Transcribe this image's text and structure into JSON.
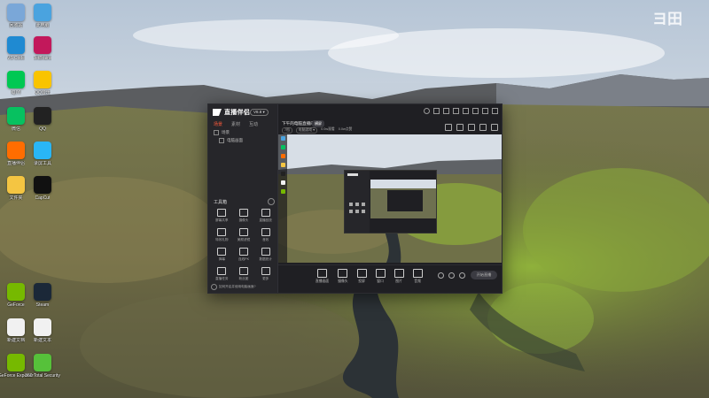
{
  "desktop": {
    "icons": [
      {
        "label": "回收站",
        "icon": "recycle-bin-icon",
        "color": "#7aa7d8"
      },
      {
        "label": "此电脑",
        "icon": "computer-icon",
        "color": "#4aa3df"
      },
      {
        "label": "VS Code",
        "icon": "vscode-icon",
        "color": "#1f8ad2"
      },
      {
        "label": "JetBrains",
        "icon": "jetbrains-icon",
        "color": "#c2185b"
      },
      {
        "label": "iQIYI",
        "icon": "iqiyi-icon",
        "color": "#00c853"
      },
      {
        "label": "QQ音乐",
        "icon": "qq-music-icon",
        "color": "#f9c400"
      },
      {
        "label": "微信",
        "icon": "wechat-icon",
        "color": "#07c160"
      },
      {
        "label": "QQ",
        "icon": "qq-icon",
        "color": "#222222"
      },
      {
        "label": "直播伴侣",
        "icon": "live-assistant-icon",
        "color": "#ff6d00"
      },
      {
        "label": "录屏工具",
        "icon": "recorder-icon",
        "color": "#29b6f6"
      },
      {
        "label": "文件夹",
        "icon": "folder-icon",
        "color": "#f4c542"
      },
      {
        "label": "CapCut",
        "icon": "capcut-icon",
        "color": "#111111"
      },
      {
        "label": "GeForce",
        "icon": "geforce-icon",
        "color": "#76b900"
      },
      {
        "label": "Steam",
        "icon": "steam-icon",
        "color": "#1b2838"
      },
      {
        "label": "新建文档",
        "icon": "document-icon",
        "color": "#f1f1f1"
      },
      {
        "label": "新建文本",
        "icon": "text-file-icon",
        "color": "#f1f1f1"
      },
      {
        "label": "GeForce Experience",
        "icon": "nvidia-icon",
        "color": "#76b900"
      },
      {
        "label": "360 Total Security",
        "icon": "security-icon",
        "color": "#56c13a"
      }
    ]
  },
  "app": {
    "logo_text": "直播伴侣",
    "version": "V8.8 ▾",
    "sidebar_tabs": [
      "场景",
      "素材",
      "互动"
    ],
    "scenes": [
      "场景",
      "电脑画面"
    ],
    "tools_title": "工具箱",
    "tools": [
      {
        "label": "屏幕共享",
        "icon": "screen-share-icon"
      },
      {
        "label": "摄像头",
        "icon": "camera-icon"
      },
      {
        "label": "直播回放",
        "icon": "replay-icon"
      },
      {
        "label": "特效礼物",
        "icon": "gift-icon"
      },
      {
        "label": "美颜滤镜",
        "icon": "beauty-icon"
      },
      {
        "label": "音效",
        "icon": "sound-icon"
      },
      {
        "label": "弹幕",
        "icon": "danmaku-icon"
      },
      {
        "label": "连线PK",
        "icon": "pk-icon"
      },
      {
        "label": "数据统计",
        "icon": "stats-icon"
      },
      {
        "label": "直播任务",
        "icon": "task-icon"
      },
      {
        "label": "粉丝团",
        "icon": "fans-icon"
      },
      {
        "label": "更多",
        "icon": "more-icon"
      }
    ],
    "footer_text": "如何开启并使用电脑画面?",
    "room_title": "下午的电脑直播间",
    "room_badge": "横屏",
    "room_meta": [
      "7档",
      "电脑游戏 ▾",
      "0.0w观看",
      "0.0w点赞"
    ],
    "bottom_buttons": [
      {
        "label": "直播画面",
        "icon": "screen-icon"
      },
      {
        "label": "摄像头",
        "icon": "camera-icon"
      },
      {
        "label": "投屏",
        "icon": "cast-icon"
      },
      {
        "label": "窗口",
        "icon": "window-icon"
      },
      {
        "label": "图片",
        "icon": "image-icon"
      },
      {
        "label": "音频",
        "icon": "audio-icon"
      }
    ],
    "start_button": "开始直播"
  }
}
